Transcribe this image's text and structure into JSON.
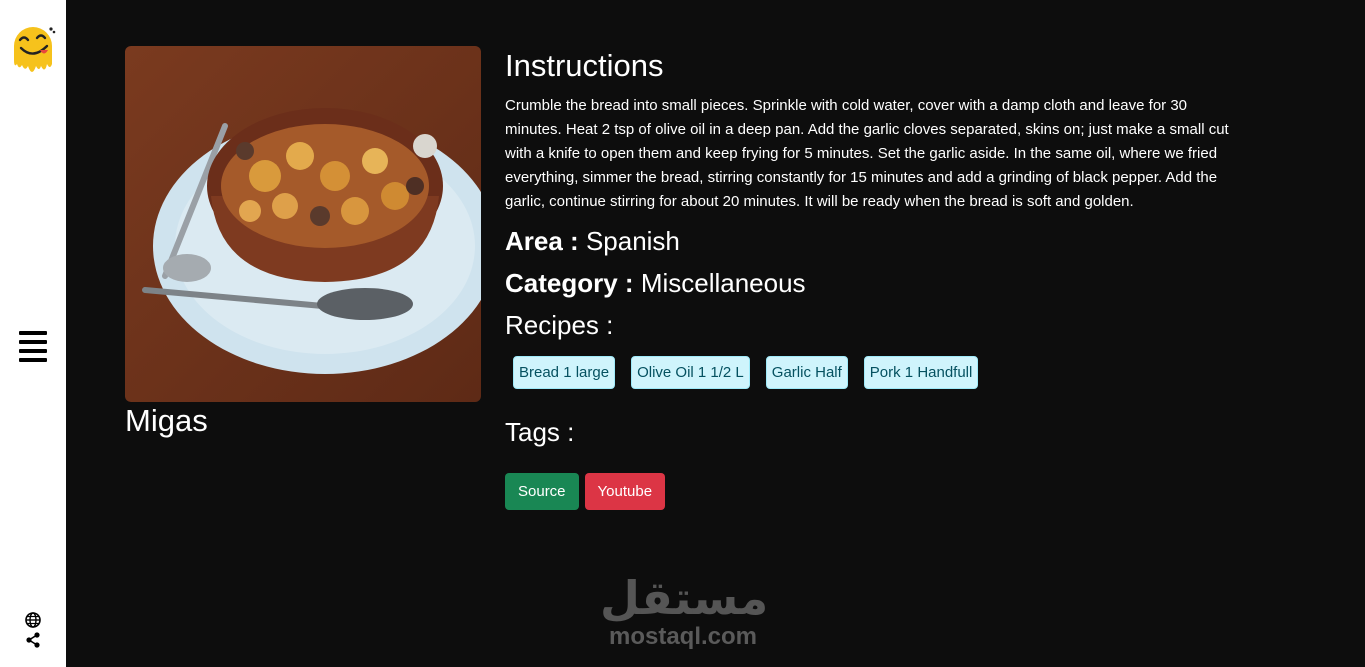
{
  "sidebar": {
    "logo_icon": "smiley-drip-logo",
    "menu_icon": "hamburger-icon",
    "bottom_icons": [
      "globe-icon",
      "share-icon"
    ]
  },
  "meal": {
    "name": "Migas",
    "image_alt": "Migas"
  },
  "instructions": {
    "heading": "Instructions",
    "text": "Crumble the bread into small pieces. Sprinkle with cold water, cover with a damp cloth and leave for 30 minutes. Heat 2 tsp of olive oil in a deep pan. Add the garlic cloves separated, skins on; just make a small cut with a knife to open them and keep frying for 5 minutes. Set the garlic aside. In the same oil, where we fried everything, simmer the bread, stirring constantly for 15 minutes and add a grinding of black pepper. Add the garlic, continue stirring for about 20 minutes. It will be ready when the bread is soft and golden."
  },
  "area": {
    "label": "Area :",
    "value": "Spanish"
  },
  "category": {
    "label": "Category :",
    "value": "Miscellaneous"
  },
  "recipes": {
    "heading": "Recipes :",
    "items": [
      "Bread 1 large",
      "Olive Oil 1 1/2 L",
      "Garlic Half",
      "Pork 1 Handfull"
    ]
  },
  "tags": {
    "heading": "Tags :"
  },
  "buttons": {
    "source": "Source",
    "youtube": "Youtube"
  },
  "colors": {
    "source": "#198754",
    "youtube": "#dc3545",
    "badge_bg": "#cff4fc",
    "badge_text": "#055160"
  },
  "watermark": {
    "arabic": "مستقل",
    "latin": "mostaql.com"
  }
}
